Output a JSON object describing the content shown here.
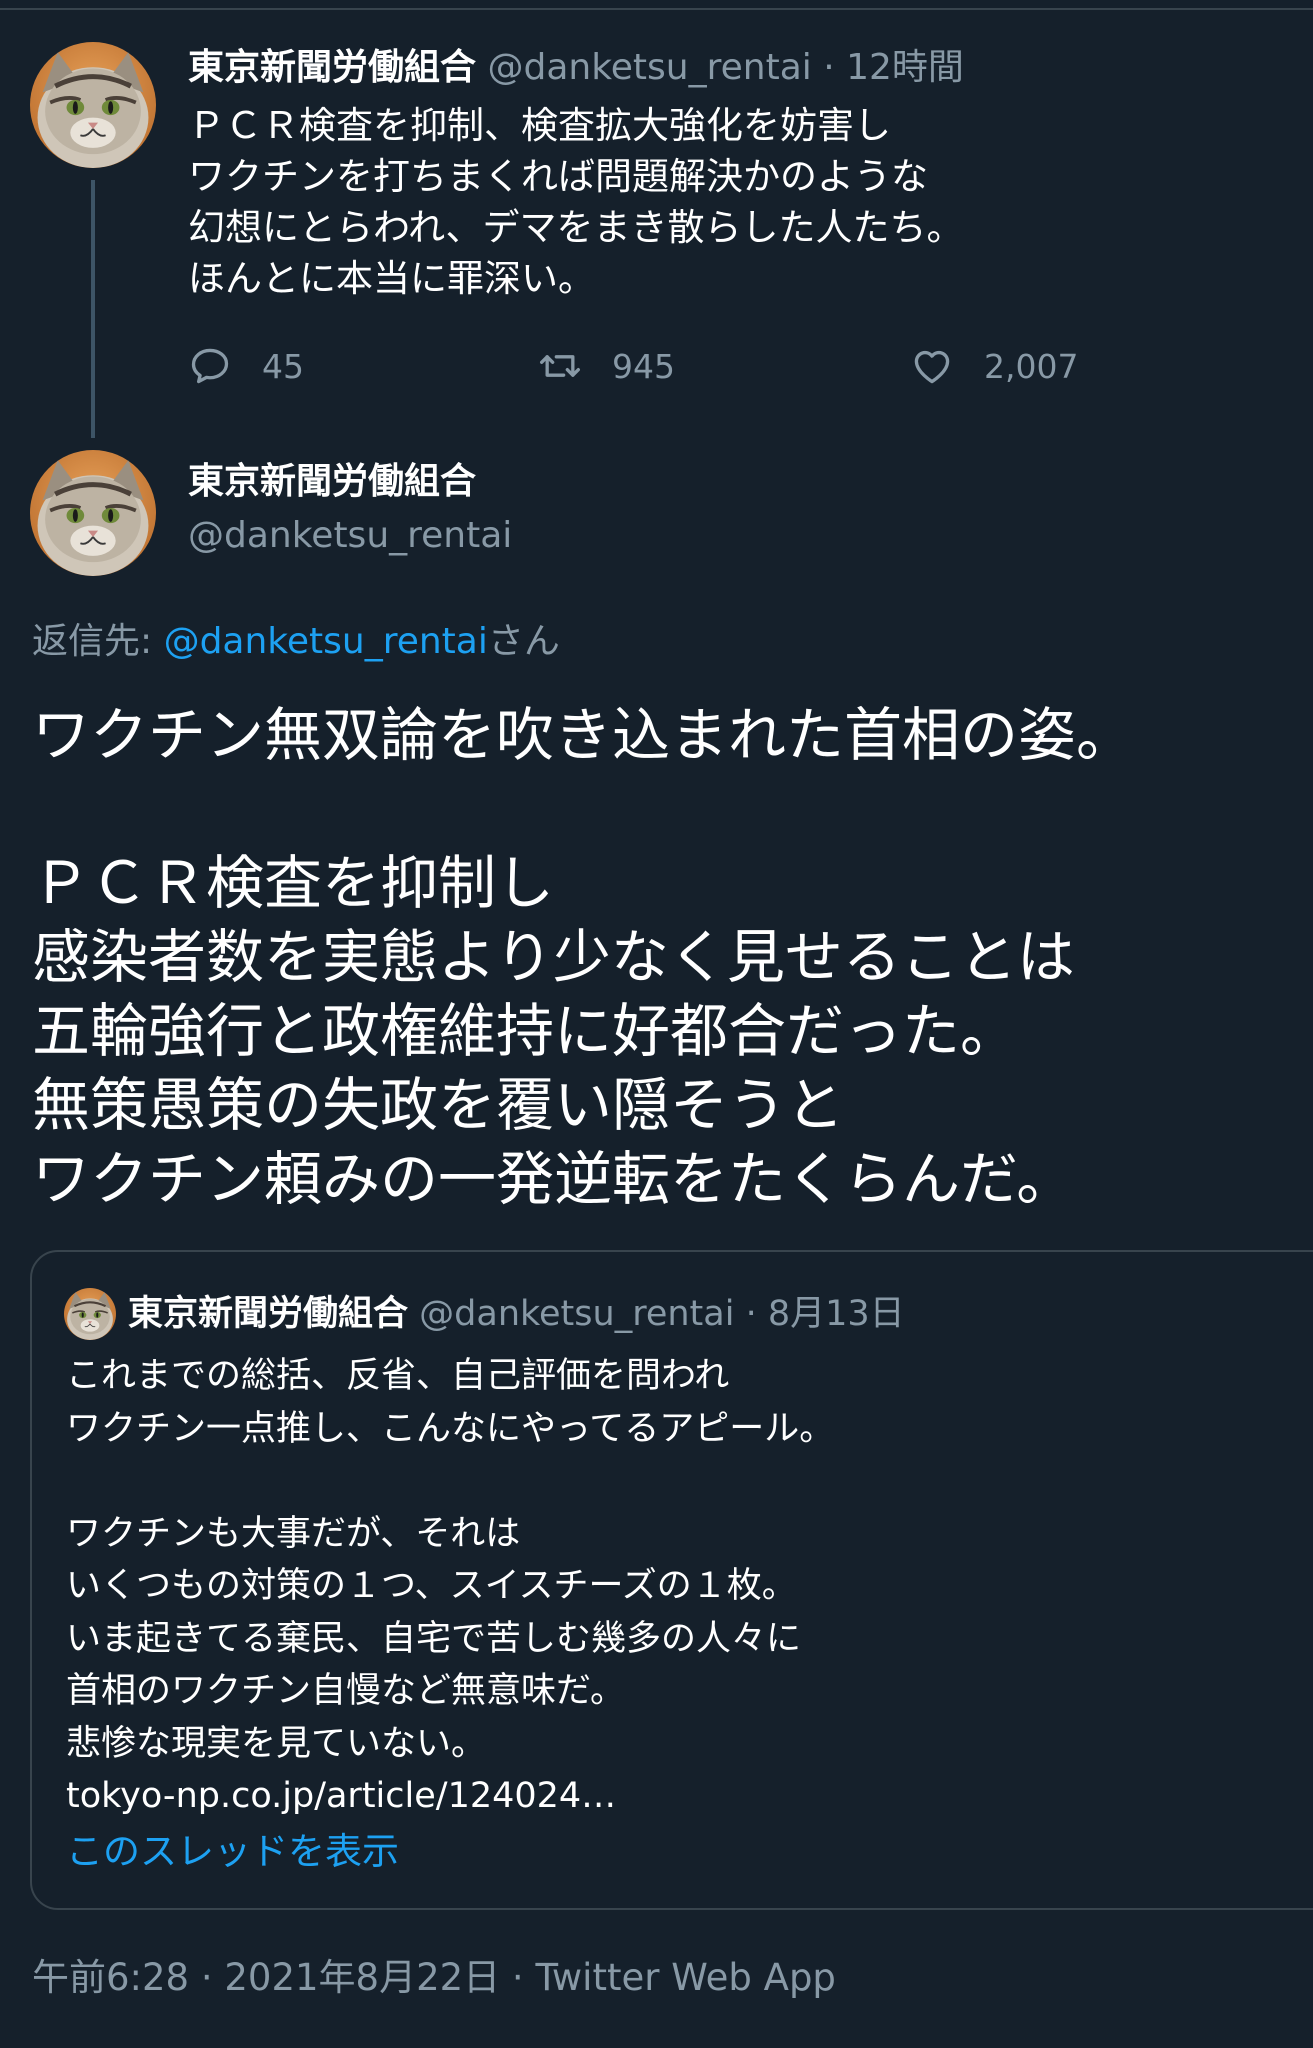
{
  "tweet1": {
    "name": "東京新聞労働組合",
    "handle": "@danketsu_rentai",
    "time": "12時間",
    "lines": [
      "ＰＣＲ検査を抑制、検査拡大強化を妨害し",
      "ワクチンを打ちまくれば問題解決かのような",
      "幻想にとらわれ、デマをまき散らした人たち。",
      "ほんとに本当に罪深い。"
    ],
    "replies": "45",
    "retweets": "945",
    "likes": "2,007"
  },
  "tweet2": {
    "name": "東京新聞労働組合",
    "handle": "@danketsu_rentai",
    "reply_prefix": "返信先: ",
    "reply_handle": "@danketsu_rentai",
    "reply_suffix": "さん",
    "lines": [
      "ワクチン無双論を吹き込まれた首相の姿。",
      "",
      "ＰＣＲ検査を抑制し",
      "感染者数を実態より少なく見せることは",
      "五輪強行と政権維持に好都合だった。",
      "無策愚策の失政を覆い隠そうと",
      "ワクチン頼みの一発逆転をたくらんだ。"
    ],
    "footer": "午前6:28 · 2021年8月22日 · Twitter Web App"
  },
  "quote": {
    "name": "東京新聞労働組合",
    "handle": "@danketsu_rentai",
    "date": "8月13日",
    "lines": [
      "これまでの総括、反省、自己評価を問われ",
      "ワクチン一点推し、こんなにやってるアピール。",
      "",
      "ワクチンも大事だが、それは",
      "いくつもの対策の１つ、スイスチーズの１枚。",
      "いま起きてる棄民、自宅で苦しむ幾多の人々に",
      "首相のワクチン自慢など無意味だ。",
      "悲惨な現実を見ていない。",
      "tokyo-np.co.jp/article/124024…"
    ],
    "thread_link": "このスレッドを表示"
  },
  "icons": {
    "avatar": "cat-avatar",
    "reply": "reply-icon",
    "retweet": "retweet-icon",
    "like": "heart-icon"
  },
  "colors": {
    "background": "#15202b",
    "muted": "#8899a6",
    "link": "#1da1f2",
    "border": "#38444d"
  }
}
